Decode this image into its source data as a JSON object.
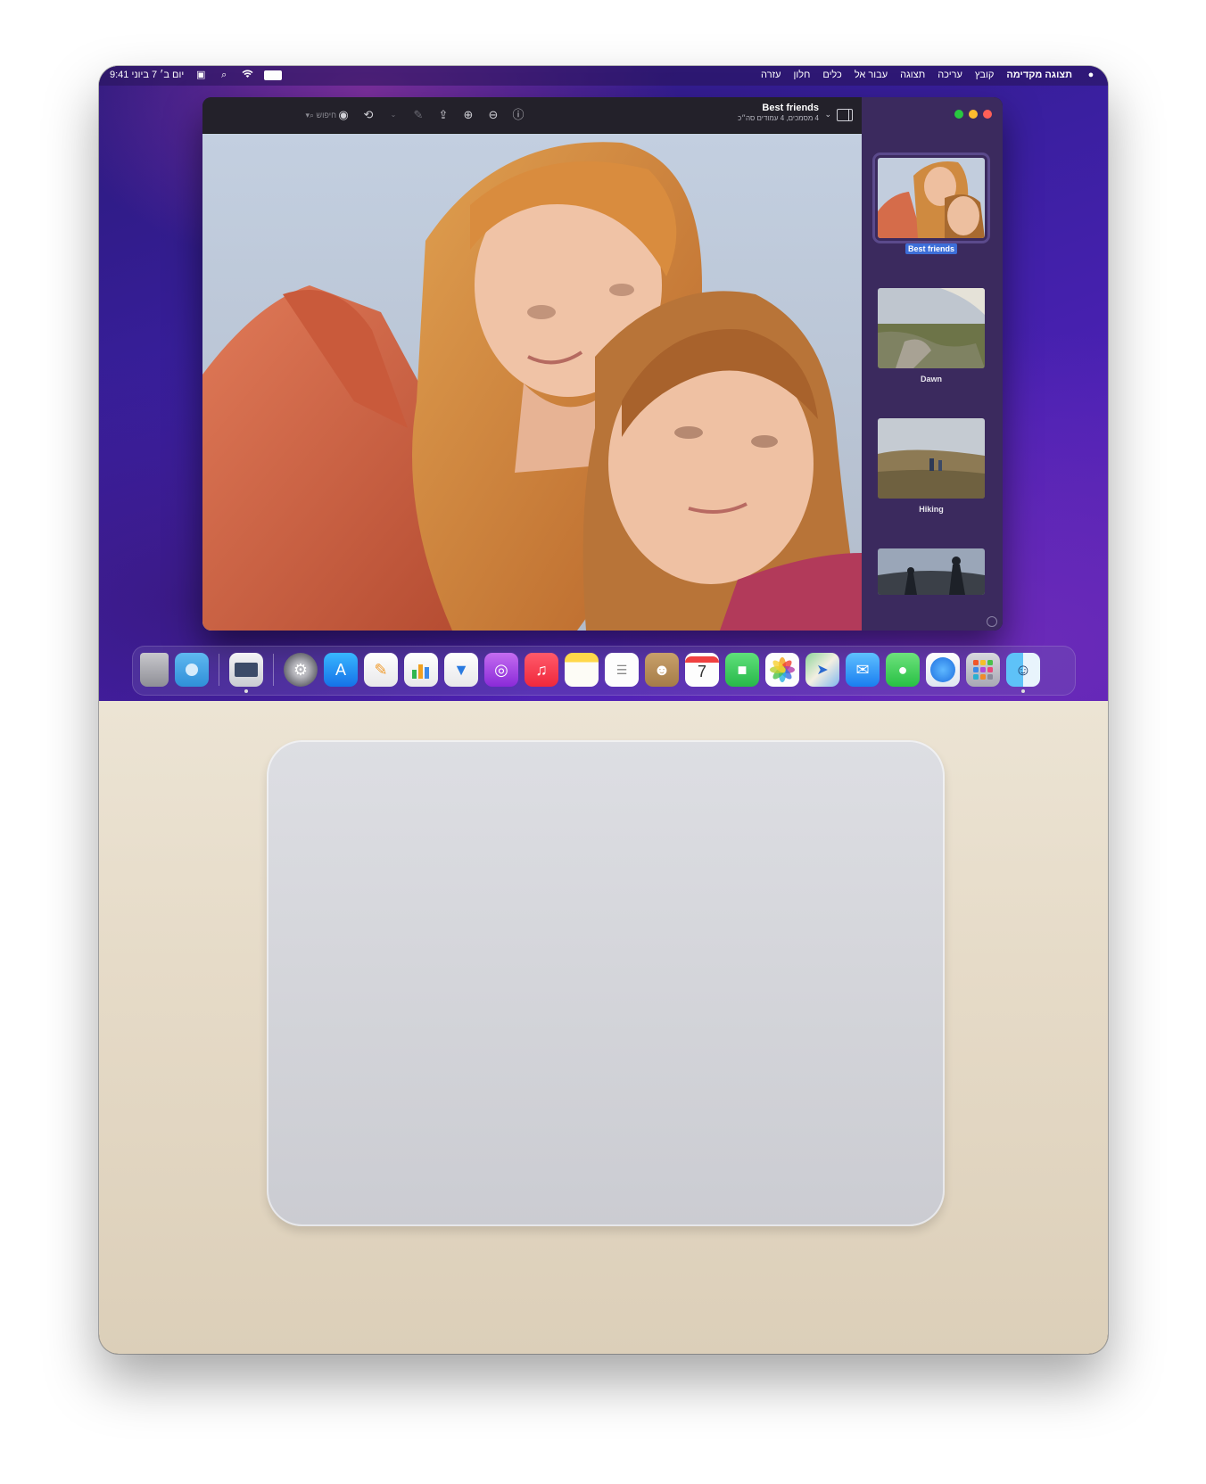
{
  "menubar": {
    "apple_icon": "apple-logo-icon",
    "app_name": "תצוגה מקדימה",
    "menus": [
      "קובץ",
      "עריכה",
      "תצוגה",
      "עבור אל",
      "כלים",
      "חלון",
      "עזרה"
    ],
    "status_icons": [
      "battery-icon",
      "wifi-icon",
      "search-icon",
      "control-center-icon"
    ],
    "clock": "יום ב׳ 7 ביוני 9:41"
  },
  "window": {
    "title": "Best friends",
    "subtitle": "4 מסמכים, 4 עמודים סה״כ",
    "search_placeholder": "חיפוש",
    "toolbar_icons": [
      "info-icon",
      "zoom-out-icon",
      "zoom-in-icon",
      "share-icon",
      "markup-icon",
      "rotate-icon",
      "highlight-icon"
    ],
    "traffic_colors": {
      "close": "#ff5f57",
      "minimize": "#febc2e",
      "zoom": "#28c840"
    },
    "thumbnails": [
      {
        "label": "Best friends",
        "selected": true
      },
      {
        "label": "Dawn",
        "selected": false
      },
      {
        "label": "Hiking",
        "selected": false
      },
      {
        "label": "",
        "selected": false
      }
    ]
  },
  "dock": {
    "items": [
      {
        "name": "trash",
        "icon": "trash-icon"
      },
      {
        "name": "downloads",
        "icon": "folder-icon"
      },
      {
        "name": "preview",
        "icon": "preview-icon",
        "running": true
      },
      {
        "name": "system-settings",
        "icon": "gear-icon"
      },
      {
        "name": "app-store",
        "icon": "app-store-icon"
      },
      {
        "name": "pages",
        "icon": "pages-icon"
      },
      {
        "name": "numbers",
        "icon": "numbers-icon"
      },
      {
        "name": "keynote",
        "icon": "keynote-icon"
      },
      {
        "name": "podcasts",
        "icon": "podcasts-icon"
      },
      {
        "name": "music",
        "icon": "music-icon"
      },
      {
        "name": "notes",
        "icon": "notes-icon"
      },
      {
        "name": "reminders",
        "icon": "reminders-icon"
      },
      {
        "name": "contacts",
        "icon": "contacts-icon"
      },
      {
        "name": "calendar",
        "icon": "calendar-icon",
        "text": "7"
      },
      {
        "name": "facetime",
        "icon": "facetime-icon"
      },
      {
        "name": "photos",
        "icon": "photos-icon"
      },
      {
        "name": "maps",
        "icon": "maps-icon"
      },
      {
        "name": "mail",
        "icon": "mail-icon"
      },
      {
        "name": "messages",
        "icon": "messages-icon"
      },
      {
        "name": "safari",
        "icon": "safari-icon"
      },
      {
        "name": "launchpad",
        "icon": "launchpad-icon"
      },
      {
        "name": "finder",
        "icon": "finder-icon",
        "running": true
      }
    ]
  }
}
